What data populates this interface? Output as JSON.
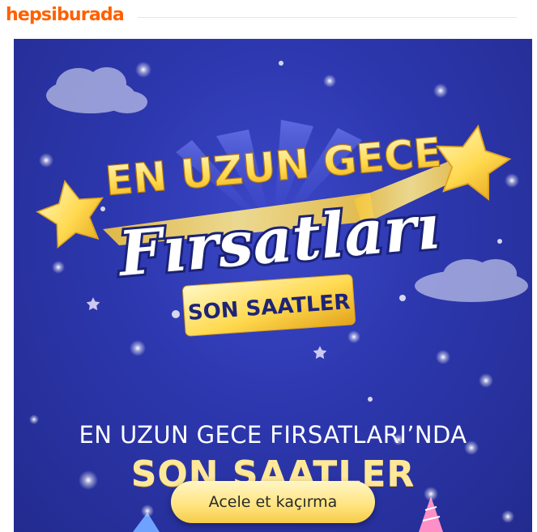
{
  "header": {
    "logo_text": "hepsiburada"
  },
  "banner": {
    "logo_line1": "EN UZUN GECE",
    "logo_script": "Fırsatları",
    "logo_badge": "SON SAATLER",
    "headline_line1": "EN UZUN GECE FIRSATLARI’NDA",
    "headline_line2": "SON SAATLER",
    "cta_label": "Acele et kaçırma"
  },
  "colors": {
    "brand": "#ff6000",
    "banner_background": "#2c37ad",
    "gold": "#ffd84a",
    "button": "#ffe37c"
  },
  "icons": [
    "star-icon",
    "cloud-icon",
    "party-hat-icon"
  ]
}
